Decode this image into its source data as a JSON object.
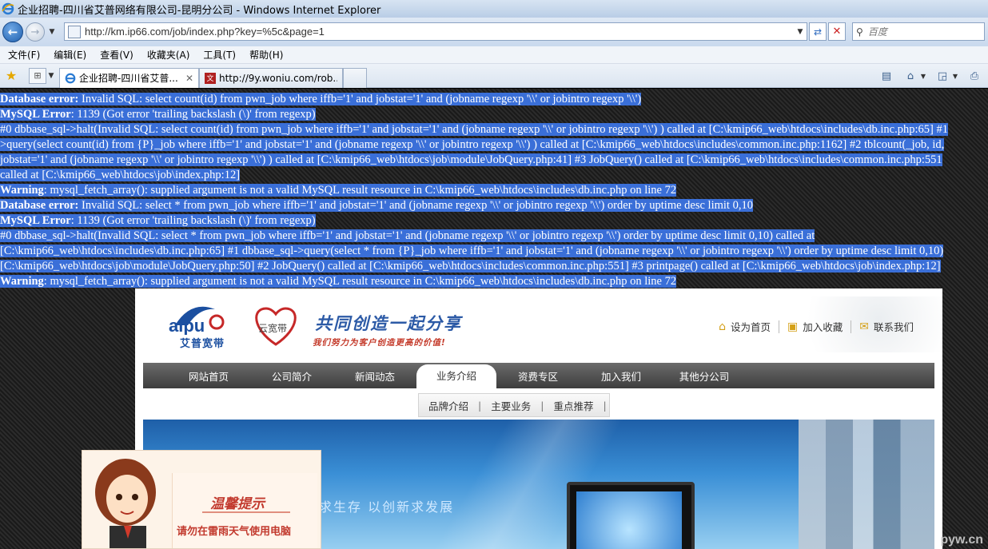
{
  "window": {
    "title": "企业招聘-四川省艾普网络有限公司-昆明分公司 - Windows Internet Explorer"
  },
  "address_bar": {
    "url": "http://km.ip66.com/job/index.php?key=%5c&page=1",
    "search_placeholder": "百度"
  },
  "menu": {
    "items": [
      "文件(F)",
      "编辑(E)",
      "查看(V)",
      "收藏夹(A)",
      "工具(T)",
      "帮助(H)"
    ]
  },
  "tabs": [
    {
      "label": "企业招聘-四川省艾普...",
      "active": true
    },
    {
      "label": "http://9y.woniu.com/rob...",
      "active": false
    }
  ],
  "errors": {
    "lines": [
      {
        "b": "Database error:",
        "t": " Invalid SQL: select count(id) from pwn_job where iffb='1' and jobstat='1' and (jobname regexp '\\\\' or jobintro regexp '\\\\')"
      },
      {
        "b": "MySQL Error",
        "t": ": 1139 (Got error 'trailing backslash (\\)' from regexp)"
      },
      {
        "b": "",
        "t": "#0 dbbase_sql->halt(Invalid SQL: select count(id) from pwn_job where iffb='1' and jobstat='1' and (jobname regexp '\\\\' or jobintro regexp '\\\\') ) called at [C:\\kmip66_web\\htdocs\\includes\\db.inc.php:65] #1"
      },
      {
        "b": "",
        "t": ">query(select count(id) from {P}_job where iffb='1' and jobstat='1' and (jobname regexp '\\\\' or jobintro regexp '\\\\') ) called at [C:\\kmip66_web\\htdocs\\includes\\common.inc.php:1162] #2 tblcount(_job, id,"
      },
      {
        "b": "",
        "t": "jobstat='1' and (jobname regexp '\\\\' or jobintro regexp '\\\\') ) called at [C:\\kmip66_web\\htdocs\\job\\module\\JobQuery.php:41] #3 JobQuery() called at [C:\\kmip66_web\\htdocs\\includes\\common.inc.php:551"
      },
      {
        "b": "",
        "t": "called at [C:\\kmip66_web\\htdocs\\job\\index.php:12]"
      },
      {
        "b": "Warning",
        "t": ": mysql_fetch_array(): supplied argument is not a valid MySQL result resource in C:\\kmip66_web\\htdocs\\includes\\db.inc.php on line 72"
      },
      {
        "b": "Database error:",
        "t": " Invalid SQL: select * from pwn_job where iffb='1' and jobstat='1' and (jobname regexp '\\\\' or jobintro regexp '\\\\') order by uptime desc limit 0,10"
      },
      {
        "b": "MySQL Error",
        "t": ": 1139 (Got error 'trailing backslash (\\)' from regexp)"
      },
      {
        "b": "",
        "t": "#0 dbbase_sql->halt(Invalid SQL: select * from pwn_job where iffb='1' and jobstat='1' and (jobname regexp '\\\\' or jobintro regexp '\\\\') order by uptime desc limit 0,10) called at"
      },
      {
        "b": "",
        "t": "[C:\\kmip66_web\\htdocs\\includes\\db.inc.php:65] #1 dbbase_sql->query(select * from {P}_job where iffb='1' and jobstat='1' and (jobname regexp '\\\\' or jobintro regexp '\\\\') order by uptime desc limit 0,10)"
      },
      {
        "b": "",
        "t": "[C:\\kmip66_web\\htdocs\\job\\module\\JobQuery.php:50] #2 JobQuery() called at [C:\\kmip66_web\\htdocs\\includes\\common.inc.php:551] #3 printpage() called at [C:\\kmip66_web\\htdocs\\job\\index.php:12]"
      },
      {
        "b": "Warning",
        "t": ": mysql_fetch_array(): supplied argument is not a valid MySQL result resource in C:\\kmip66_web\\htdocs\\includes\\db.inc.php on line 72"
      }
    ]
  },
  "site": {
    "logo_text": "艾普宽带",
    "logo_mark": "aipu",
    "logo2_text": "云宽带",
    "slogan": "共同创造一起分享",
    "slogan_sub": "我们努力为客户创造更高的价值!",
    "header_links": [
      "设为首页",
      "加入收藏",
      "联系我们"
    ],
    "nav": [
      "网站首页",
      "公司简介",
      "新闻动态",
      "业务介绍",
      "资费专区",
      "加入我们",
      "其他分公司"
    ],
    "nav_active_index": 3,
    "subnav": [
      "品牌介绍",
      "主要业务",
      "重点推荐"
    ],
    "banner_text": "求生存 以创新求发展"
  },
  "popup": {
    "title": "温馨提示",
    "message": "请勿在雷雨天气使用电脑"
  },
  "watermark": "pyw.cn"
}
